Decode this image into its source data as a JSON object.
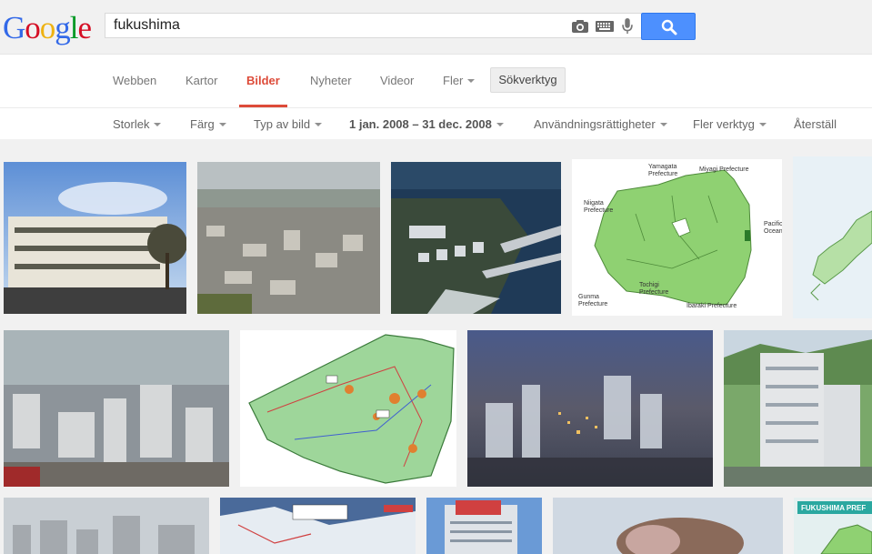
{
  "logo": {
    "letters": [
      "G",
      "o",
      "o",
      "g",
      "l",
      "e"
    ],
    "colors": [
      "#3369e8",
      "#d50f25",
      "#eeb211",
      "#3369e8",
      "#009925",
      "#d50f25"
    ]
  },
  "search": {
    "query": "fukushima",
    "icons": [
      "camera-icon",
      "keyboard-icon",
      "microphone-icon"
    ],
    "button_icon": "magnifier-icon"
  },
  "nav": {
    "items": [
      "Webben",
      "Kartor",
      "Bilder",
      "Nyheter",
      "Videor",
      "Fler"
    ],
    "active": "Bilder",
    "tools_label": "Sökverktyg"
  },
  "tools": {
    "size": "Storlek",
    "color": "Färg",
    "type": "Typ av bild",
    "date": "1 jan. 2008 – 31 dec. 2008",
    "rights": "Användningsrättigheter",
    "more": "Fler verktyg",
    "reset": "Återställ"
  },
  "map_labels": {
    "yamagata": "Yamagata\nPrefecture",
    "miyagi": "Miyagi Prefecture",
    "niigata": "Niigata\nPrefecture",
    "pacific": "Pacific\nOcean",
    "gunma": "Gunma\nPrefecture",
    "tochigi": "Tochigi\nPrefecture",
    "ibaraki": "Ibaraki Prefecture"
  },
  "banner_text": "FUKUSHIMA PREF",
  "colors": {
    "accent": "#dd4b39",
    "search_button": "#4d90fe",
    "map_green": "#8fd172"
  }
}
